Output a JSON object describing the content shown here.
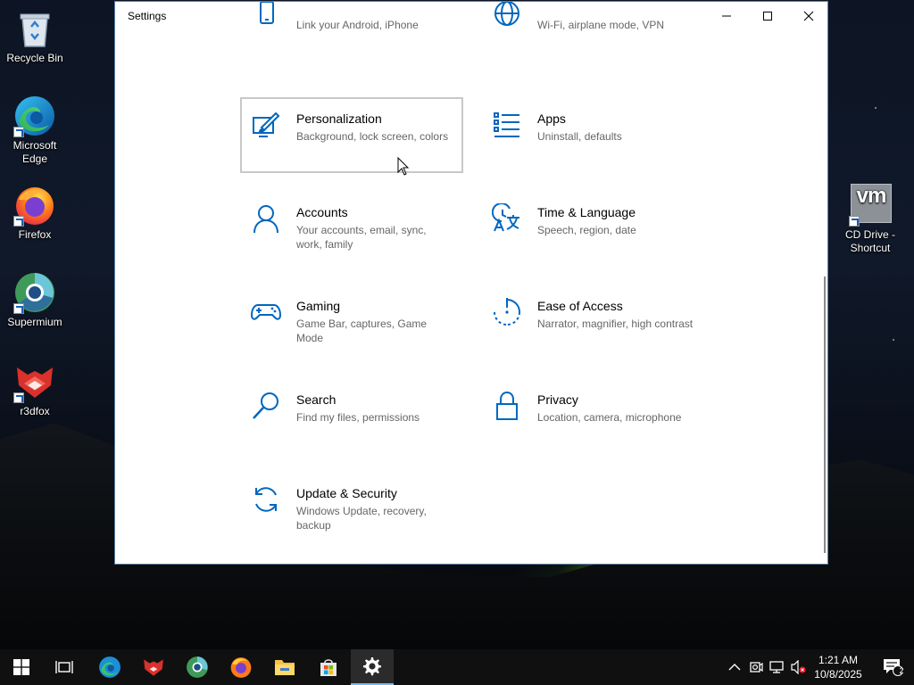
{
  "desktop": {
    "icons": [
      {
        "label": "Recycle Bin",
        "icon": "recycle-bin-icon"
      },
      {
        "label": "Microsoft Edge",
        "icon": "edge-icon"
      },
      {
        "label": "Firefox",
        "icon": "firefox-icon"
      },
      {
        "label": "Supermium",
        "icon": "supermium-icon"
      },
      {
        "label": "r3dfox",
        "icon": "r3dfox-icon"
      },
      {
        "label": "CD Drive - Shortcut",
        "icon": "vm-cd-drive-icon",
        "badge": "vm"
      }
    ]
  },
  "window": {
    "title": "Settings",
    "controls": {
      "minimize": "minimize-icon",
      "maximize": "maximize-icon",
      "close": "close-icon"
    },
    "top_partial": [
      {
        "description": "Link your Android, iPhone",
        "icon": "phone-icon"
      },
      {
        "description": "Wi-Fi, airplane mode, VPN",
        "icon": "globe-icon"
      }
    ],
    "categories": [
      {
        "title": "Personalization",
        "description": "Background, lock screen, colors",
        "icon": "personalization-icon",
        "hovered": true
      },
      {
        "title": "Apps",
        "description": "Uninstall, defaults",
        "icon": "apps-icon"
      },
      {
        "title": "Accounts",
        "description": "Your accounts, email, sync, work, family",
        "icon": "accounts-icon"
      },
      {
        "title": "Time & Language",
        "description": "Speech, region, date",
        "icon": "time-language-icon"
      },
      {
        "title": "Gaming",
        "description": "Game Bar, captures, Game Mode",
        "icon": "gaming-icon"
      },
      {
        "title": "Ease of Access",
        "description": "Narrator, magnifier, high contrast",
        "icon": "ease-of-access-icon"
      },
      {
        "title": "Search",
        "description": "Find my files, permissions",
        "icon": "search-icon"
      },
      {
        "title": "Privacy",
        "description": "Location, camera, microphone",
        "icon": "privacy-icon"
      },
      {
        "title": "Update & Security",
        "description": "Windows Update, recovery, backup",
        "icon": "update-security-icon"
      }
    ]
  },
  "taskbar": {
    "apps": [
      {
        "icon": "start-icon"
      },
      {
        "icon": "task-view-icon"
      },
      {
        "icon": "edge-icon"
      },
      {
        "icon": "r3dfox-icon"
      },
      {
        "icon": "supermium-icon"
      },
      {
        "icon": "firefox-icon"
      },
      {
        "icon": "file-explorer-icon"
      },
      {
        "icon": "store-icon"
      },
      {
        "icon": "settings-icon",
        "active": true
      }
    ],
    "tray": {
      "time": "1:21 AM",
      "date": "10/8/2025",
      "notification_count": "2"
    }
  },
  "colors": {
    "accent": "#0067c0",
    "taskbar": "#101010",
    "active_indicator": "#76b9ed"
  }
}
